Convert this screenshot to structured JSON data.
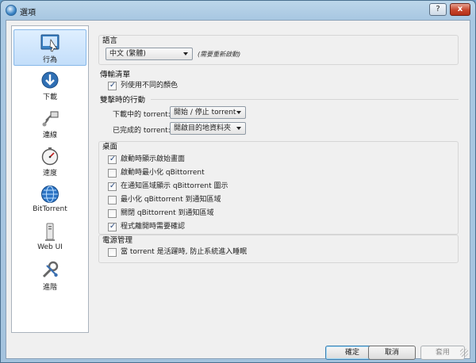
{
  "window": {
    "title": "選項",
    "help_label": "?",
    "close_label": "x"
  },
  "sidebar": {
    "items": [
      {
        "label": "行為",
        "icon": "behavior-icon",
        "selected": true
      },
      {
        "label": "下載",
        "icon": "download-icon"
      },
      {
        "label": "連線",
        "icon": "connection-icon"
      },
      {
        "label": "速度",
        "icon": "speed-icon"
      },
      {
        "label": "BitTorrent",
        "icon": "bittorrent-icon"
      },
      {
        "label": "Web UI",
        "icon": "webui-icon"
      },
      {
        "label": "進階",
        "icon": "advanced-icon"
      }
    ]
  },
  "language": {
    "title": "語言",
    "selected": "中文 (繁體)",
    "hint": "(需要重新啟動)"
  },
  "transfer_list": {
    "title": "傳輸清單",
    "alt_colors": {
      "label": "列使用不同的顏色",
      "checked": true
    },
    "double_click_title": "雙擊時的行動",
    "downloading_label": "下載中的 torrent:",
    "downloading_value": "開始 / 停止 torrent",
    "completed_label": "已完成的 torrent:",
    "completed_value": "開啟目的地資料夾"
  },
  "desktop": {
    "title": "桌面",
    "options": [
      {
        "label": "啟動時顯示啟始畫面",
        "checked": true
      },
      {
        "label": "啟動時最小化 qBittorrent",
        "checked": false
      },
      {
        "label": "在通知區域顯示 qBittorrent 圖示",
        "checked": true
      },
      {
        "label": "最小化 qBittorrent 到通知區域",
        "checked": false
      },
      {
        "label": "關閉 qBittorrent 到通知區域",
        "checked": false
      },
      {
        "label": "程式離開時需要確認",
        "checked": true
      }
    ]
  },
  "power": {
    "title": "電源管理",
    "inhibit": {
      "label": "當 torrent 是活躍時, 防止系統進入睡眠",
      "checked": false
    }
  },
  "buttons": {
    "ok": "確定",
    "cancel": "取消",
    "apply": "套用"
  }
}
